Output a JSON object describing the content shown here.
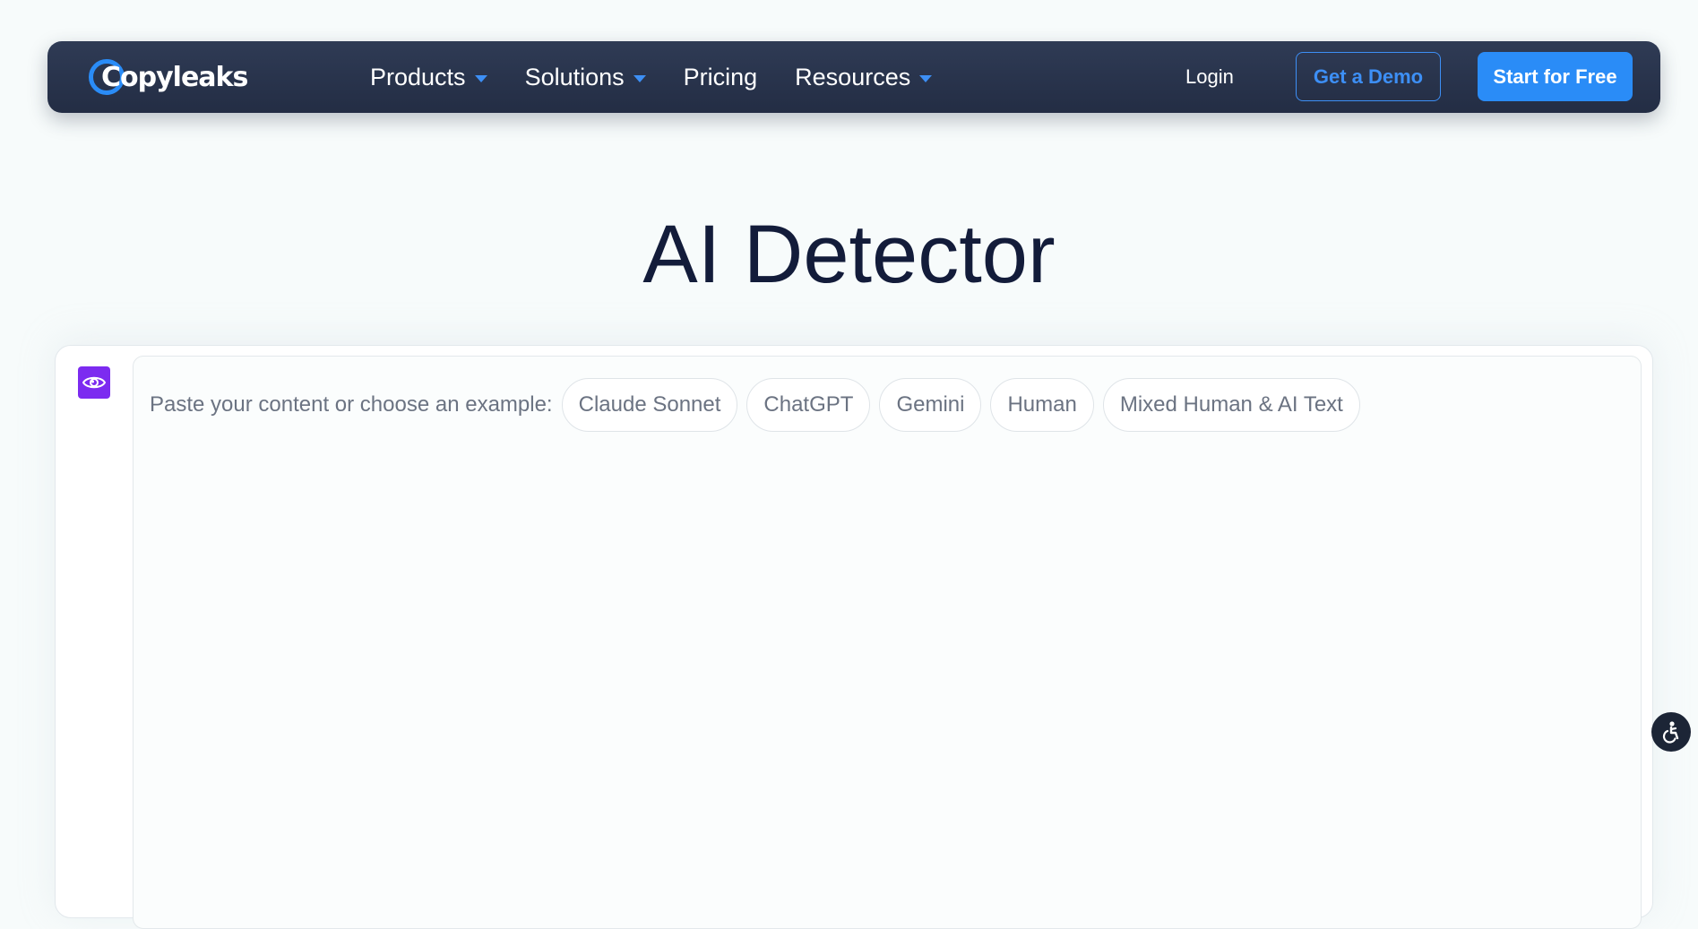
{
  "nav": {
    "logo_text": "Copyleaks",
    "items": [
      {
        "label": "Products",
        "has_dropdown": true
      },
      {
        "label": "Solutions",
        "has_dropdown": true
      },
      {
        "label": "Pricing",
        "has_dropdown": false
      },
      {
        "label": "Resources",
        "has_dropdown": true
      }
    ],
    "login_label": "Login",
    "demo_label": "Get a Demo",
    "cta_label": "Start for Free"
  },
  "main": {
    "title": "AI Detector",
    "prompt_label": "Paste your content or choose an example:",
    "examples": [
      "Claude Sonnet",
      "ChatGPT",
      "Gemini",
      "Human",
      "Mixed Human & AI Text"
    ]
  },
  "icons": {
    "scan": "eye-icon",
    "accessibility": "accessibility-icon",
    "dropdown": "caret-down-icon"
  },
  "colors": {
    "nav_bg": "#27324b",
    "accent_blue": "#2a8cf7",
    "purple": "#7c2bf0",
    "title": "#131c3a",
    "page_bg": "#f7fbfb"
  }
}
